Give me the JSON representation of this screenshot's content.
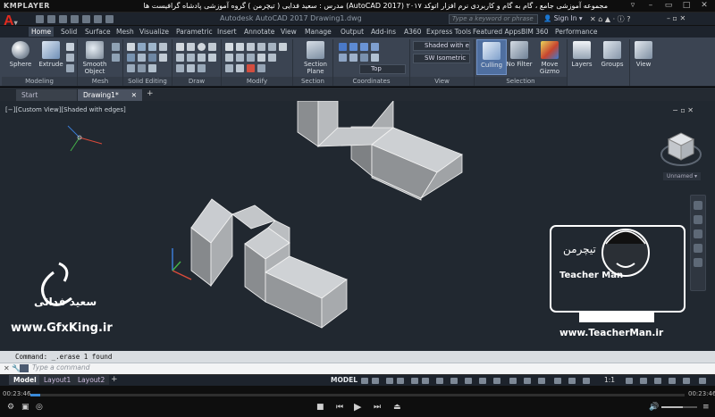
{
  "player": {
    "logo": "KMPLAYER",
    "title": "مجموعه آموزشی جامع ، گام به گام و کاربردی نرم افزار   اتوکد ۲۰۱۷ (AutoCAD 2017)  مدرس : سعید فدایی ( تیچرمن ) گروه آموزشی پادشاه گرافیست ها",
    "time_elapsed": "00:23:46",
    "time_total": "00:23:46",
    "seek_fraction": 0.015,
    "volume_fraction": 0.6
  },
  "acad": {
    "app_letter": "A",
    "doc_title": "Autodesk AutoCAD 2017    Drawing1.dwg",
    "search_placeholder": "Type a keyword or phrase",
    "sign_in": "Sign In",
    "accent_color": "#e02b1f"
  },
  "ribbon": {
    "tabs": [
      "Home",
      "Solid",
      "Surface",
      "Mesh",
      "Visualize",
      "Parametric",
      "Insert",
      "Annotate",
      "View",
      "Manage",
      "Output",
      "Add-ins",
      "A360",
      "Express Tools",
      "Featured Apps",
      "BIM 360",
      "Performance"
    ],
    "active_tab": 0,
    "panels": [
      "Modeling",
      "Mesh",
      "Solid Editing",
      "Draw",
      "Modify",
      "Section",
      "Coordinates",
      "View",
      "Selection"
    ],
    "big_buttons": {
      "sphere": "Sphere",
      "extrude": "Extrude",
      "smooth_object": "Smooth Object",
      "section_plane": "Section Plane",
      "culling": "Culling",
      "no_filter": "No Filter",
      "move_gizmo": "Move Gizmo",
      "layers": "Layers",
      "groups": "Groups",
      "view": "View"
    },
    "visual_style": "Shaded with e...",
    "view_preset": "SW Isometric",
    "ucs_preset": "Top"
  },
  "file_tabs": [
    "Start",
    "Drawing1*"
  ],
  "viewport": {
    "label": "[−][Custom View][Shaded with edges]",
    "ctrls": "−  ▫  ✕",
    "viewcube_label": "Unnamed ▾"
  },
  "watermarks": {
    "left_name": "سعید فدائی",
    "left_url": "www.GfxKing.ir",
    "right_url": "www.TeacherMan.ir",
    "right_logo_fa": "تیچرمن",
    "right_logo_en": "Teacher Man"
  },
  "command": {
    "history": "Command: _.erase 1 found",
    "placeholder": "Type a command"
  },
  "layout_tabs": [
    "Model",
    "Layout1",
    "Layout2"
  ],
  "status": {
    "model": "MODEL",
    "scale": "1:1"
  }
}
